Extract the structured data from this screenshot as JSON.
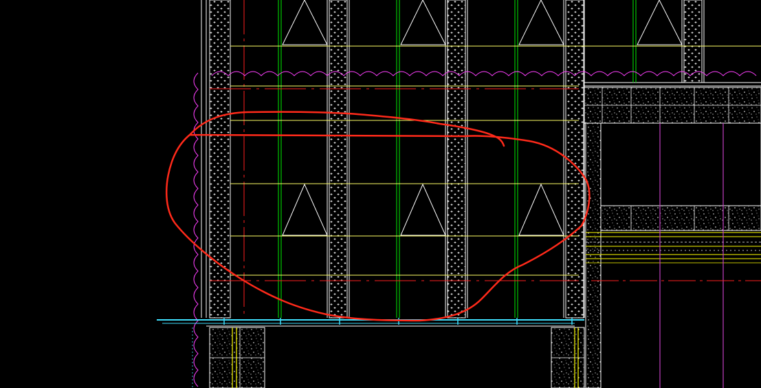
{
  "drawing": {
    "background": "#000000",
    "colors": {
      "wall_outline": "#ffffff",
      "stud": "#00c800",
      "batten": "#ffff66",
      "section_line": "#ff2020",
      "hatch_magenta": "#ff40ff",
      "magenta_line": "#c040c0",
      "cyan_line": "#40e0ff",
      "markup_cloud": "#ff2a1a",
      "insulation_dots": "#ffffff",
      "concrete_speckle": "#ffffff",
      "floor_yellow": "#ffff00"
    },
    "elements": {
      "columns": "insulated-columns",
      "truss_triangles": "truss-triangles",
      "revision_cloud": "red-markup-cloud"
    }
  }
}
